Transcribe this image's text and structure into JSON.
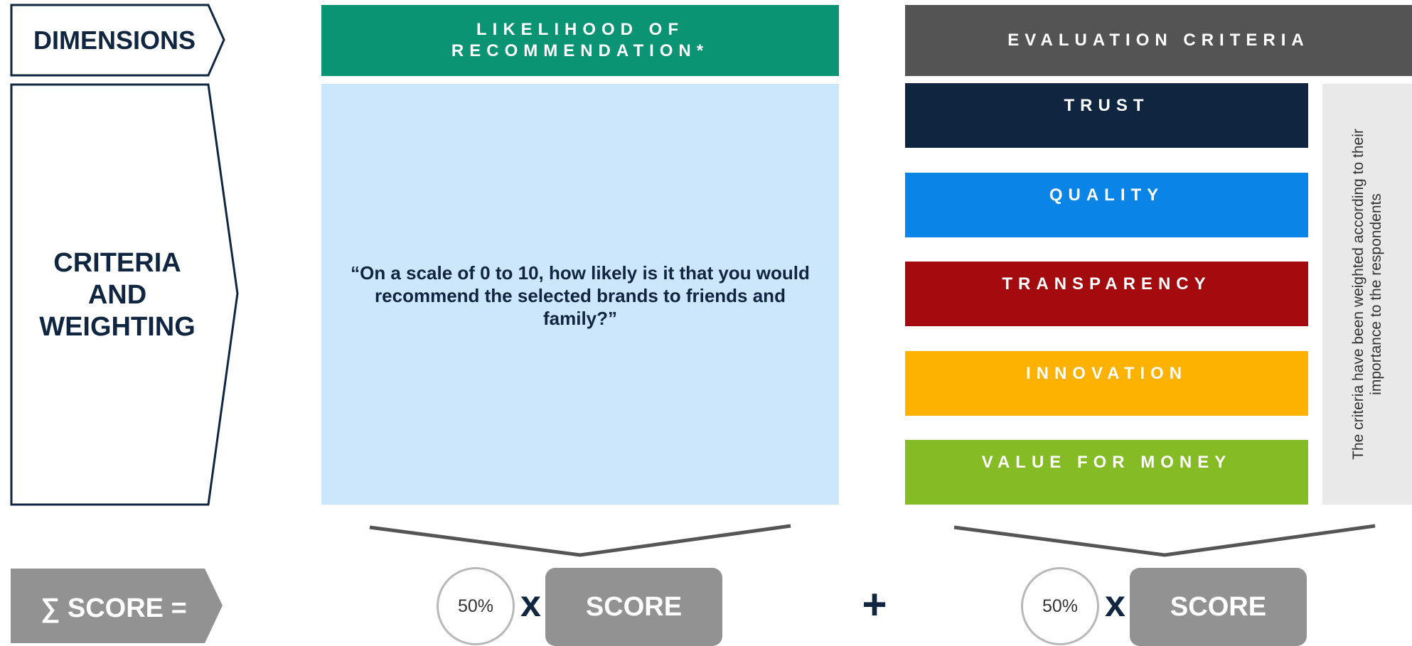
{
  "dimensions_label": "DIMENSIONS",
  "criteria_label": "CRITERIA AND WEIGHTING",
  "score_formula": "∑ SCORE =",
  "likelihood": {
    "header": "LIKELIHOOD OF RECOMMENDATION*",
    "question": "“On a scale of 0 to 10, how likely is it that you would recommend the selected brands to friends and family?”",
    "weight": "50%",
    "multiply": "x",
    "score_label": "SCORE"
  },
  "plus": "+",
  "evaluation": {
    "header": "EVALUATION CRITERIA",
    "criteria": [
      {
        "label": "TRUST",
        "color": "#10253f"
      },
      {
        "label": "QUALITY",
        "color": "#0b84e8"
      },
      {
        "label": "TRANSPARENCY",
        "color": "#a30b0f"
      },
      {
        "label": "INNOVATION",
        "color": "#fdb100"
      },
      {
        "label": "VALUE FOR MONEY",
        "color": "#85bb25"
      }
    ],
    "weighting_note": "The criteria have been weighted according to their importance to the respondents",
    "weight": "50%",
    "multiply": "x",
    "score_label": "SCORE"
  },
  "colors": {
    "navy": "#10253f",
    "green_header": "#0a9474",
    "gray_header": "#545454",
    "light_blue": "#cce6fb",
    "note_bg": "#e9e9e9",
    "score_gray": "#929292"
  }
}
